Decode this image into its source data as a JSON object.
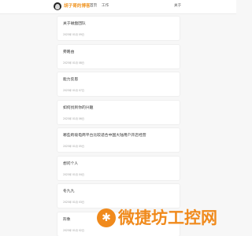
{
  "header": {
    "site_title": "胡子哥的博客",
    "nav": [
      {
        "label": "首页"
      },
      {
        "label": "工作"
      }
    ],
    "about_label": "关于"
  },
  "posts": [
    {
      "title": "关于磁盘团队",
      "date": "2025年 01月 09日"
    },
    {
      "title": "旁路由",
      "date": "2025年 01月 08日"
    },
    {
      "title": "能力反思",
      "date": "2025年 01月 07日"
    },
    {
      "title": "如何找到你的兴趣",
      "date": "2025年 01月 06日"
    },
    {
      "title": "哪些跨境电商平台比较适合中国大陆用户开店经营",
      "date": "2025年 01月 05日"
    },
    {
      "title": "想问个人",
      "date": "2025年 01月 04日"
    },
    {
      "title": "冬九九",
      "date": "2025年 01月 03日"
    },
    {
      "title": "形象",
      "date": "2025年 01月 02日"
    }
  ],
  "watermark": {
    "logo_glyph": "✱",
    "text": "微捷坊工控网"
  },
  "colors": {
    "accent": "#f0982a",
    "watermark": "#f08a1c"
  }
}
